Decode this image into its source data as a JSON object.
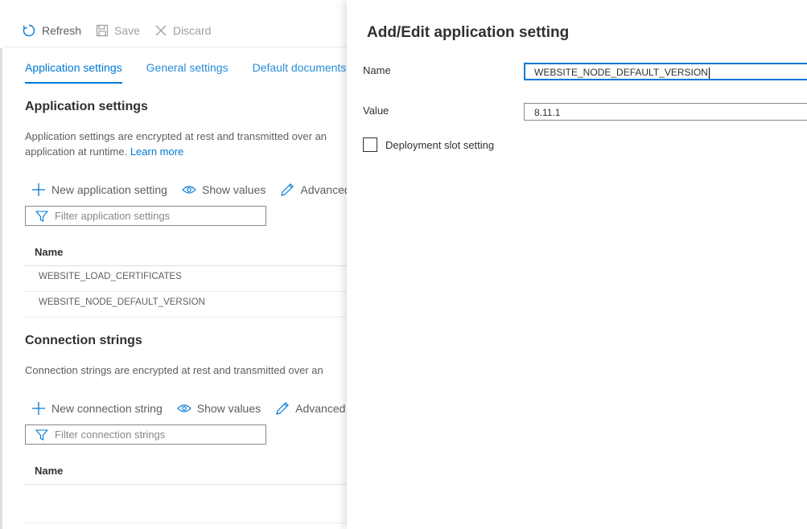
{
  "toolbar": {
    "refresh_label": "Refresh",
    "save_label": "Save",
    "discard_label": "Discard"
  },
  "tabs": [
    {
      "label": "Application settings",
      "active": true
    },
    {
      "label": "General settings",
      "active": false
    },
    {
      "label": "Default documents",
      "active": false
    }
  ],
  "app_settings": {
    "title": "Application settings",
    "description_line1": "Application settings are encrypted at rest and transmitted over an",
    "description_line2": "application at runtime.",
    "learn_more": "Learn more",
    "commands": {
      "new": "New application setting",
      "show_values": "Show values",
      "advanced": "Advanced"
    },
    "filter_placeholder": "Filter application settings",
    "column_name": "Name",
    "rows": [
      {
        "name": "WEBSITE_LOAD_CERTIFICATES"
      },
      {
        "name": "WEBSITE_NODE_DEFAULT_VERSION"
      }
    ]
  },
  "connection_strings": {
    "title": "Connection strings",
    "description": "Connection strings are encrypted at rest and transmitted over an",
    "commands": {
      "new": "New connection string",
      "show_values": "Show values",
      "advanced": "Advanced e"
    },
    "filter_placeholder": "Filter connection strings",
    "column_name": "Name"
  },
  "blade": {
    "title": "Add/Edit application setting",
    "name_label": "Name",
    "name_value": "WEBSITE_NODE_DEFAULT_VERSION",
    "value_label": "Value",
    "value_value": "8.11.1",
    "slot_setting_label": "Deployment slot setting",
    "slot_setting_checked": false
  },
  "colors": {
    "accent": "#0078d4",
    "text": "#323130",
    "muted": "#605e5c",
    "border": "#8a8886"
  }
}
